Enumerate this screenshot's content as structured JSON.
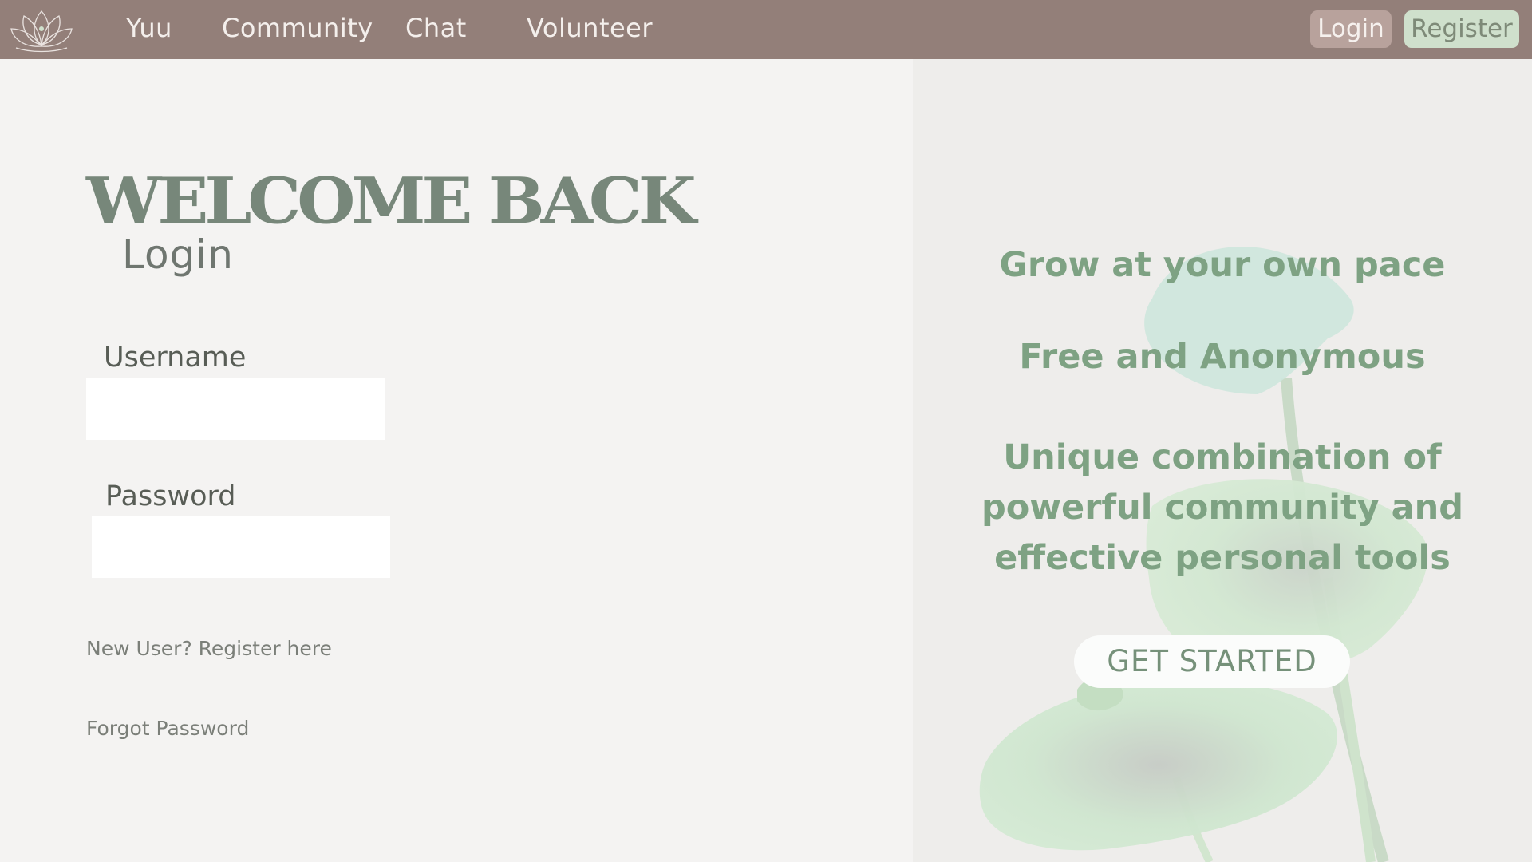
{
  "nav": {
    "brand_icon": "lotus-icon",
    "links": [
      "Yuu",
      "Community",
      "Chat",
      "Volunteer"
    ],
    "login_label": "Login",
    "register_label": "Register"
  },
  "login": {
    "heading": "WELCOME BACK",
    "subheading": "Login",
    "username_label": "Username",
    "username_value": "",
    "password_label": "Password",
    "password_value": "",
    "register_link": "New User? Register here",
    "forgot_link": "Forgot Password"
  },
  "promo": {
    "line1": "Grow at your own pace",
    "line2": "Free and Anonymous",
    "line3a": "Unique combination of",
    "line3b": "powerful community and",
    "line3c": "effective personal tools",
    "cta_label": "GET STARTED"
  },
  "colors": {
    "topbar": "#937f79",
    "accent_green": "#7ea283",
    "heading_green": "#77877a",
    "login_button": "#b8a29c",
    "register_button": "#cfe0cc"
  }
}
